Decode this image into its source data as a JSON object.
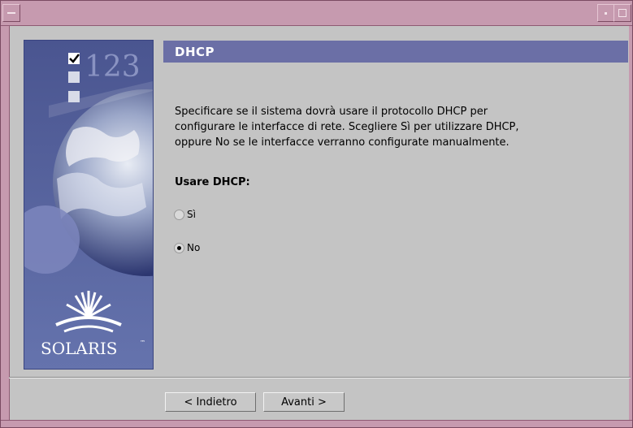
{
  "window": {
    "colors": {
      "frame": "#c69aaf",
      "body": "#c4c4c4",
      "header": "#6b6fa6"
    }
  },
  "sidebar": {
    "step_text": "123",
    "brand": "SOLARIS",
    "trademark": "™"
  },
  "header": {
    "title": "DHCP"
  },
  "body": {
    "description_lines": [
      "Specificare se il sistema dovrà usare il protocollo DHCP per",
      "configurare le interfacce di rete. Scegliere Sì per utilizzare DHCP,",
      "oppure No se le interfacce verranno configurate manualmente."
    ],
    "question": "Usare DHCP:",
    "options": [
      {
        "label": "Sì",
        "selected": false
      },
      {
        "label": "No",
        "selected": true
      }
    ]
  },
  "buttons": {
    "back": "< Indietro",
    "next": "Avanti >"
  }
}
